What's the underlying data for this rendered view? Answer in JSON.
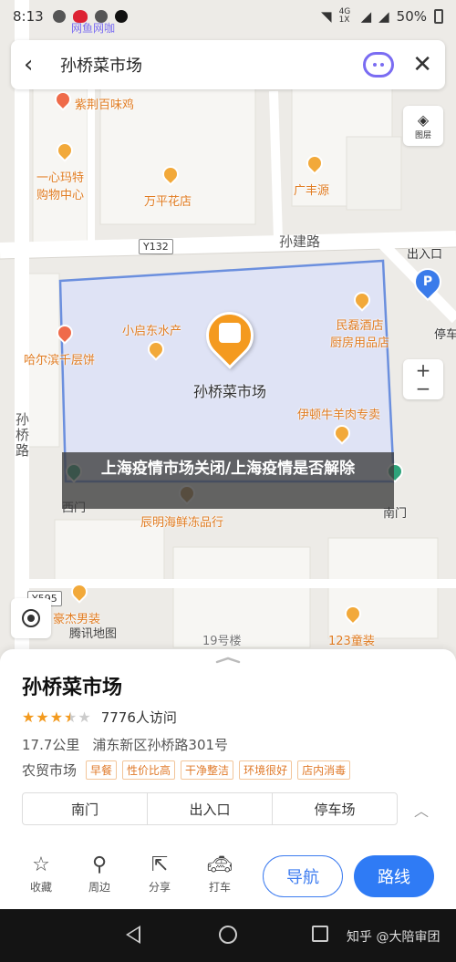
{
  "status_bar": {
    "time": "8:13",
    "network": "4G 1X",
    "battery": "50%"
  },
  "search": {
    "query": "孙桥菜市场"
  },
  "map": {
    "layers_label": "图层",
    "zoom_in": "+",
    "zoom_out": "−",
    "watermark": "腾讯地图",
    "store_label": "网鱼网咖",
    "center_poi": "孙桥菜市场",
    "roads": {
      "sunjian": "孙建路",
      "sunqiao": "孙桥路",
      "y132": "Y132",
      "y595": "Y595"
    },
    "pois": {
      "zijing": "紫荆百味鸡",
      "yixinmate": "一心玛特\n购物中心",
      "wanping": "万平花店",
      "guangfeng": "广丰源",
      "chukou_top": "出入口",
      "parking_top": "停车",
      "xiaoqidong": "小启东水产",
      "minlei": "民磊酒店\n厨房用品店",
      "harbin": "哈尔滨千层饼",
      "yidun": "伊顿牛羊肉专卖",
      "ximen": "西门",
      "nanmen": "南门",
      "chenming": "辰明海鲜冻品行",
      "haoyang": "豪杰男装",
      "building19": "19号楼",
      "tongzhuang": "123童装"
    }
  },
  "headline": {
    "text": "上海疫情市场关闭/上海疫情是否解除"
  },
  "place": {
    "name": "孙桥菜市场",
    "rating": 3.5,
    "visits": "7776人访问",
    "distance": "17.7公里",
    "address": "浦东新区孙桥路301号",
    "category": "农贸市场",
    "tags": [
      "早餐",
      "性价比高",
      "干净整洁",
      "环境很好",
      "店内消毒"
    ],
    "entrances": [
      "南门",
      "出入口",
      "停车场"
    ]
  },
  "actions": {
    "favorite": "收藏",
    "nearby": "周边",
    "share": "分享",
    "taxi": "打车",
    "navigate": "导航",
    "route": "路线"
  },
  "footer": {
    "watermark": "知乎 @大陪审团"
  },
  "colors": {
    "accent_blue": "#2f7bf5",
    "poi_orange": "#f49a1f",
    "area_fill": "#dfe3f5",
    "area_border": "#6b8fde"
  }
}
